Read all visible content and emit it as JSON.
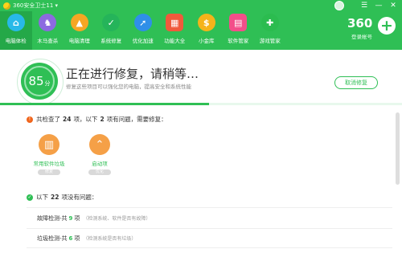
{
  "window": {
    "title": "360安全卫士11 ▾",
    "controls": [
      "☰",
      "—",
      "✕"
    ]
  },
  "nav": {
    "items": [
      {
        "label": "电脑体检",
        "icon": "pc-check-icon",
        "glyph": "⌂",
        "color": "#28b9e8",
        "active": true
      },
      {
        "label": "木马查杀",
        "icon": "horse-icon",
        "glyph": "♞",
        "color": "#8c6ae0",
        "active": false
      },
      {
        "label": "电脑清理",
        "icon": "broom-icon",
        "glyph": "▲",
        "color": "#f5a623",
        "active": false
      },
      {
        "label": "系统修复",
        "icon": "shield-icon",
        "glyph": "✓",
        "color": "#25b45a",
        "active": false
      },
      {
        "label": "优化加速",
        "icon": "rocket-icon",
        "glyph": "➚",
        "color": "#2f8fe8",
        "active": false
      },
      {
        "label": "功能大全",
        "icon": "grid-icon",
        "glyph": "▦",
        "color": "#f05a3c",
        "active": false
      },
      {
        "label": "小金库",
        "icon": "coin-icon",
        "glyph": "$",
        "color": "#f5b31a",
        "active": false
      },
      {
        "label": "软件管家",
        "icon": "apps-icon",
        "glyph": "▤",
        "color": "#f34f8a",
        "active": false
      },
      {
        "label": "游戏管家",
        "icon": "gamepad-icon",
        "glyph": "✚",
        "color": "#2bbc4f",
        "active": false
      }
    ]
  },
  "brand": {
    "logo_text": "360",
    "sub": "登录帐号",
    "plus": "+"
  },
  "status": {
    "score": "85",
    "score_unit": "分",
    "title": "正在进行修复，请稍等…",
    "subtitle": "修复这些项目可以强化您的电脑，提高安全和系统性能",
    "cancel_label": "取消修复",
    "progress": 0.52
  },
  "issues": {
    "prefix": "共检查了",
    "checked": "24",
    "middle": "项，以下",
    "problem_count": "2",
    "suffix": "项有问题，需要修复：",
    "items": [
      {
        "label": "常用软件垃圾",
        "glyph": "▥",
        "state": "修复"
      },
      {
        "label": "启动项",
        "glyph": "⌃",
        "state": "优化"
      }
    ]
  },
  "ok_section": {
    "prefix": "以下",
    "count": "22",
    "suffix": "项没有问题：",
    "rows": [
      {
        "name": "故障检测-共",
        "count": "9",
        "unit": "项",
        "desc": "（检测系统、软件是否有故障）"
      },
      {
        "name": "垃圾检测-共",
        "count": "6",
        "unit": "项",
        "desc": "（检测系统是否有垃圾）"
      }
    ]
  },
  "colors": {
    "accent": "#2fbf55",
    "warning": "#f0651c",
    "fix_icon": "#f5a047"
  }
}
